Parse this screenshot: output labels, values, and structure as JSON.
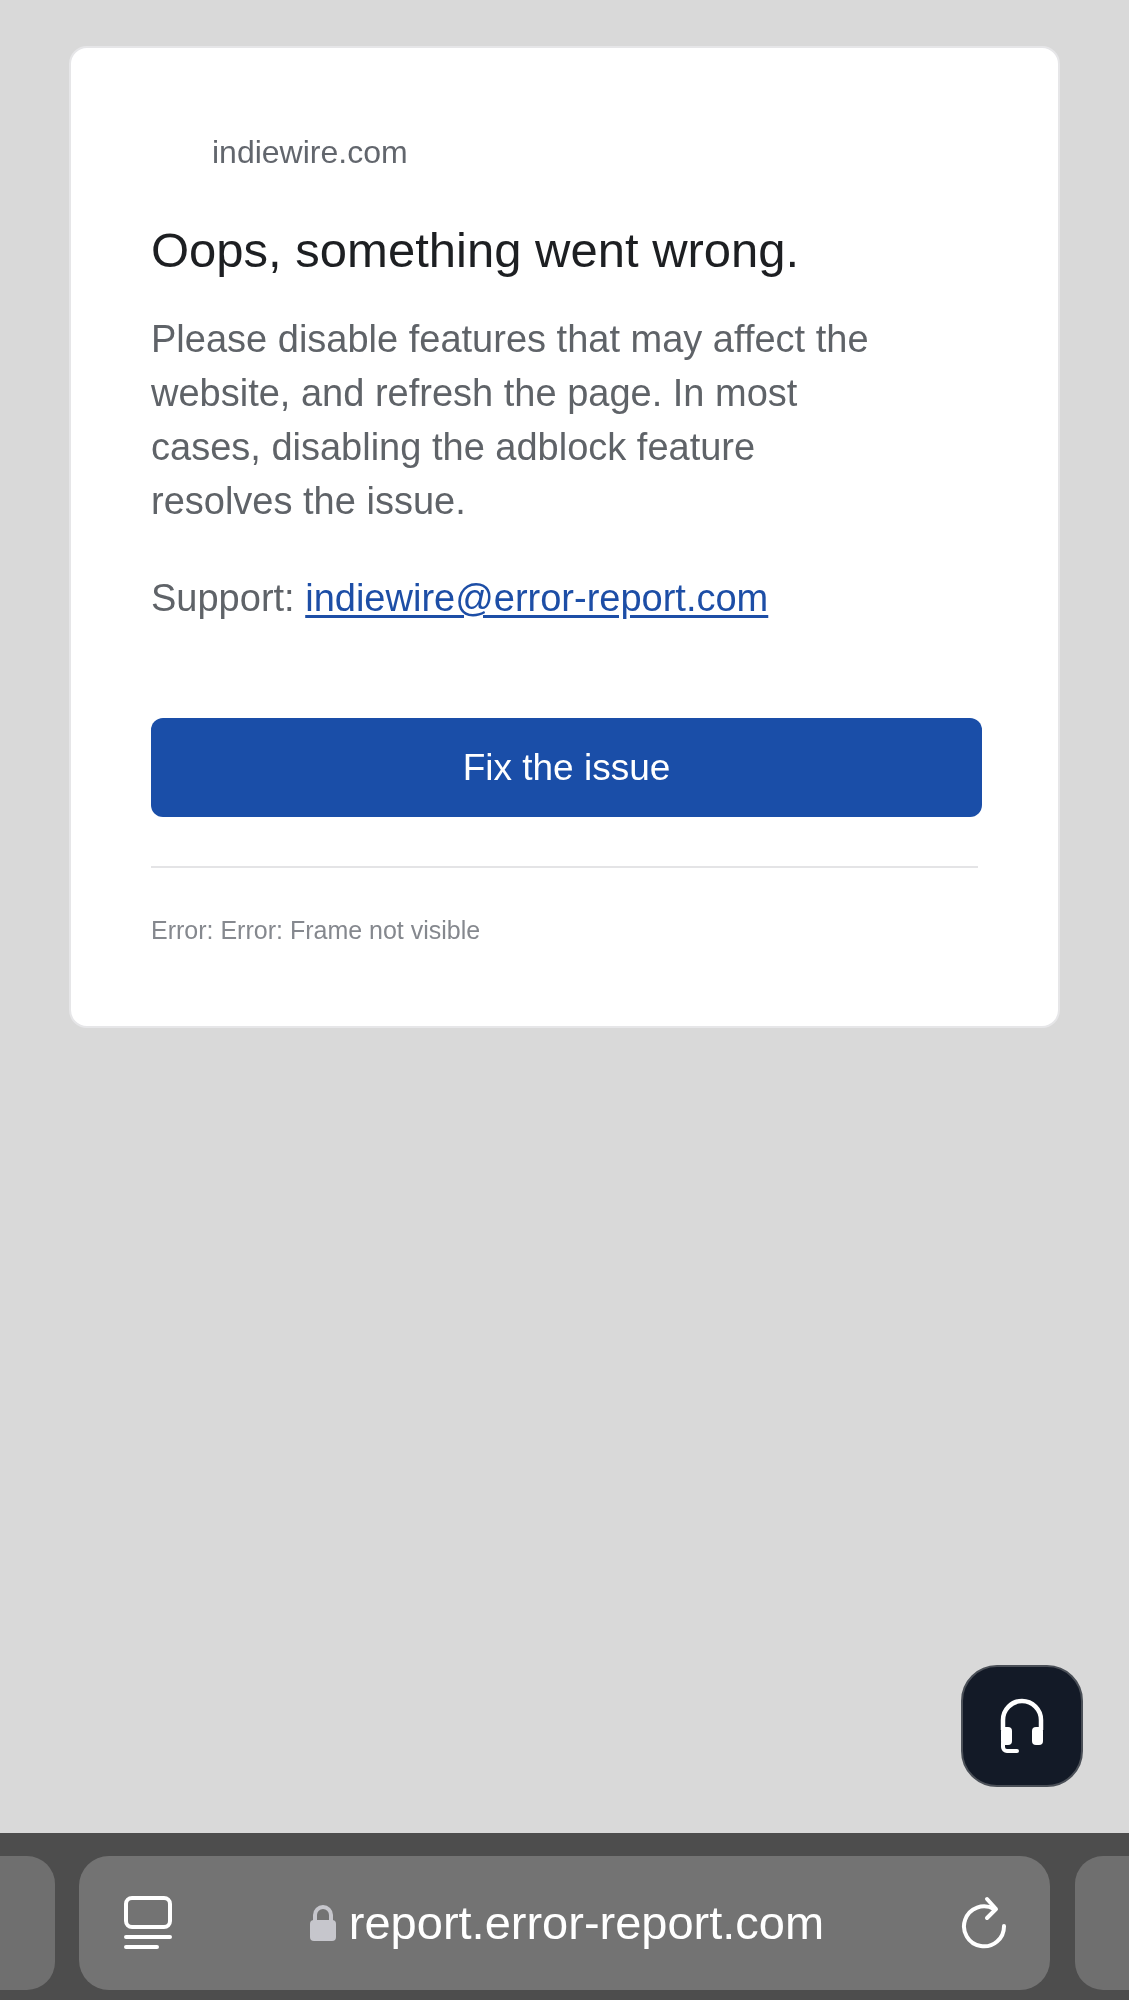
{
  "card": {
    "site": "indiewire.com",
    "title": "Oops, something went wrong.",
    "message": "Please disable features that may affect the website, and refresh the page. In most cases, disabling the adblock feature resolves the issue.",
    "support_label": "Support:",
    "support_email": "indiewire@error-report.com",
    "button": "Fix the issue",
    "error": "Error: Error: Frame not visible"
  },
  "browser_bar": {
    "url": "report.error-report.com"
  }
}
